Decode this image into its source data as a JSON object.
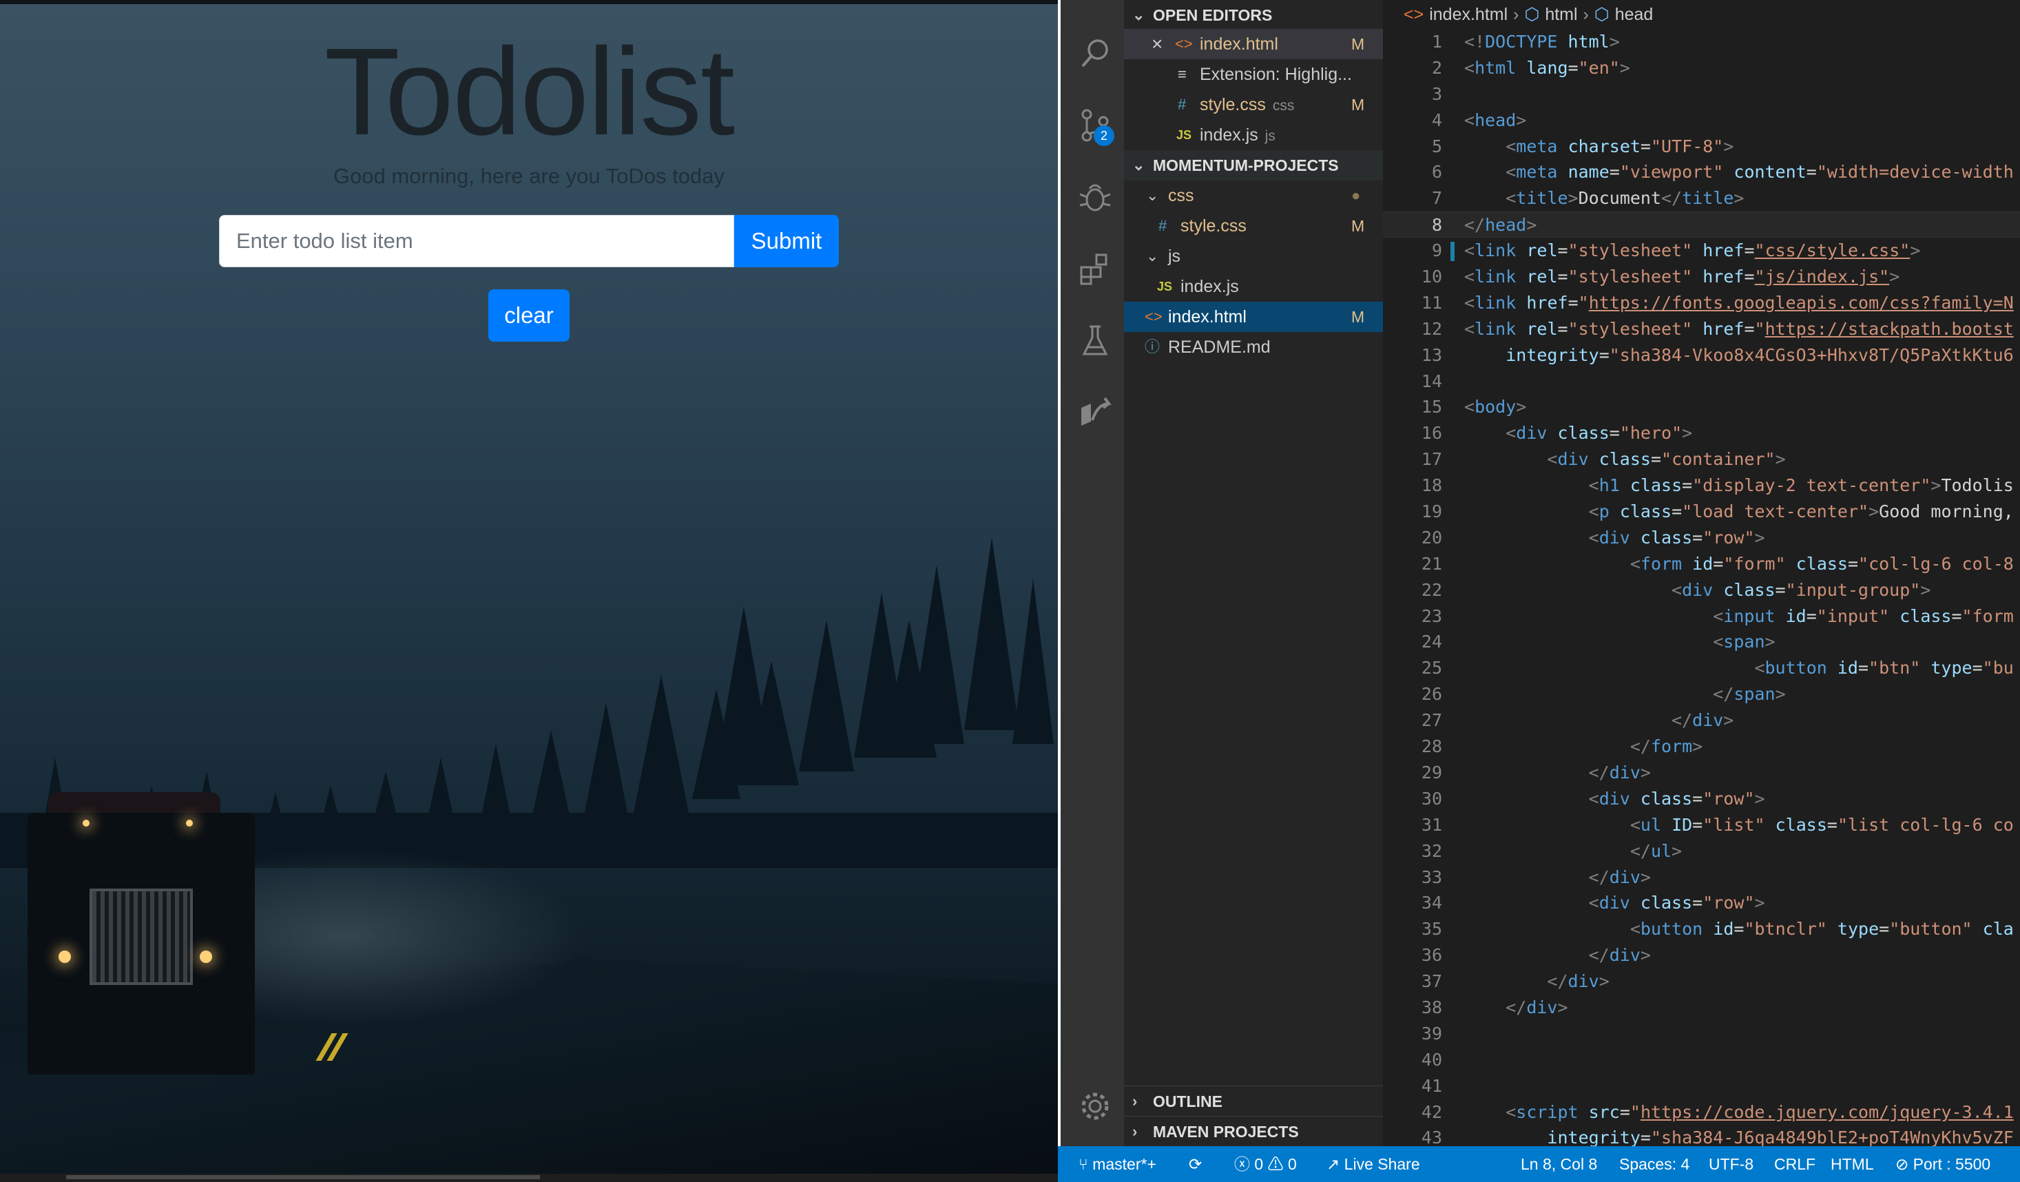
{
  "preview": {
    "title": "Todolist",
    "subtitle": "Good morning, here are you ToDos today",
    "input_placeholder": "Enter todo list item",
    "submit_label": "Submit",
    "clear_label": "clear"
  },
  "activity_bar": {
    "items": [
      "search-icon",
      "source-control-icon",
      "debug-icon",
      "extensions-icon",
      "testing-icon",
      "live-share-icon"
    ],
    "source_control_badge": "2",
    "bottom": "settings-gear-icon"
  },
  "sidebar": {
    "open_editors_header": "OPEN EDITORS",
    "open_editors": [
      {
        "icon": "<>",
        "name": "index.html",
        "status": "M",
        "close": "×"
      },
      {
        "icon": "≡",
        "name": "Extension: Highlig..."
      },
      {
        "icon": "#",
        "name": "style.css",
        "dim": "css",
        "status": "M"
      },
      {
        "icon": "JS",
        "name": "index.js",
        "dim": "js"
      }
    ],
    "project_header": "MOMENTUM-PROJECTS",
    "tree": [
      {
        "icon": "⌄",
        "name": "css",
        "status": "●"
      },
      {
        "icon": "#",
        "name": "style.css",
        "status": "M"
      },
      {
        "icon": "⌄",
        "name": "js"
      },
      {
        "icon": "JS",
        "name": "index.js"
      },
      {
        "icon": "<>",
        "name": "index.html",
        "status": "M"
      },
      {
        "icon": "ⓘ",
        "name": "README.md"
      }
    ],
    "outline_header": "OUTLINE",
    "maven_header": "MAVEN PROJECTS"
  },
  "editor": {
    "breadcrumb": [
      "index.html",
      "html",
      "head"
    ],
    "current_line": 8,
    "lines": [
      [
        [
          "t-brk",
          "<!"
        ],
        [
          "t-tag",
          "DOCTYPE"
        ],
        [
          "t-txt",
          " "
        ],
        [
          "t-attr",
          "html"
        ],
        [
          "t-brk",
          ">"
        ]
      ],
      [
        [
          "t-brk",
          "<"
        ],
        [
          "t-tag",
          "html"
        ],
        [
          "t-txt",
          " "
        ],
        [
          "t-attr",
          "lang"
        ],
        [
          "t-txt",
          "="
        ],
        [
          "t-str",
          "\"en\""
        ],
        [
          "t-brk",
          ">"
        ]
      ],
      [],
      [
        [
          "t-brk",
          "<"
        ],
        [
          "t-tag",
          "head"
        ],
        [
          "t-brk",
          ">"
        ]
      ],
      [
        [
          "t-txt",
          "    "
        ],
        [
          "t-brk",
          "<"
        ],
        [
          "t-tag",
          "meta"
        ],
        [
          "t-txt",
          " "
        ],
        [
          "t-attr",
          "charset"
        ],
        [
          "t-txt",
          "="
        ],
        [
          "t-str",
          "\"UTF-8\""
        ],
        [
          "t-brk",
          ">"
        ]
      ],
      [
        [
          "t-txt",
          "    "
        ],
        [
          "t-brk",
          "<"
        ],
        [
          "t-tag",
          "meta"
        ],
        [
          "t-txt",
          " "
        ],
        [
          "t-attr",
          "name"
        ],
        [
          "t-txt",
          "="
        ],
        [
          "t-str",
          "\"viewport\""
        ],
        [
          "t-txt",
          " "
        ],
        [
          "t-attr",
          "content"
        ],
        [
          "t-txt",
          "="
        ],
        [
          "t-str",
          "\"width=device-width"
        ]
      ],
      [
        [
          "t-txt",
          "    "
        ],
        [
          "t-brk",
          "<"
        ],
        [
          "t-tag",
          "title"
        ],
        [
          "t-brk",
          ">"
        ],
        [
          "t-txt",
          "Document"
        ],
        [
          "t-brk",
          "</"
        ],
        [
          "t-tag",
          "title"
        ],
        [
          "t-brk",
          ">"
        ]
      ],
      [
        [
          "t-brk",
          "</"
        ],
        [
          "t-tag",
          "head"
        ],
        [
          "t-brk",
          ">"
        ]
      ],
      [
        [
          "t-brk",
          "<"
        ],
        [
          "t-tag",
          "link"
        ],
        [
          "t-txt",
          " "
        ],
        [
          "t-attr",
          "rel"
        ],
        [
          "t-txt",
          "="
        ],
        [
          "t-str",
          "\"stylesheet\""
        ],
        [
          "t-txt",
          " "
        ],
        [
          "t-attr",
          "href"
        ],
        [
          "t-txt",
          "="
        ],
        [
          "t-url",
          "\"css/style.css\""
        ],
        [
          "t-brk",
          ">"
        ]
      ],
      [
        [
          "t-brk",
          "<"
        ],
        [
          "t-tag",
          "link"
        ],
        [
          "t-txt",
          " "
        ],
        [
          "t-attr",
          "rel"
        ],
        [
          "t-txt",
          "="
        ],
        [
          "t-str",
          "\"stylesheet\""
        ],
        [
          "t-txt",
          " "
        ],
        [
          "t-attr",
          "href"
        ],
        [
          "t-txt",
          "="
        ],
        [
          "t-url",
          "\"js/index.js\""
        ],
        [
          "t-brk",
          ">"
        ]
      ],
      [
        [
          "t-brk",
          "<"
        ],
        [
          "t-tag",
          "link"
        ],
        [
          "t-txt",
          " "
        ],
        [
          "t-attr",
          "href"
        ],
        [
          "t-txt",
          "="
        ],
        [
          "t-str",
          "\""
        ],
        [
          "t-url",
          "https://fonts.googleapis.com/css?family=N"
        ]
      ],
      [
        [
          "t-brk",
          "<"
        ],
        [
          "t-tag",
          "link"
        ],
        [
          "t-txt",
          " "
        ],
        [
          "t-attr",
          "rel"
        ],
        [
          "t-txt",
          "="
        ],
        [
          "t-str",
          "\"stylesheet\""
        ],
        [
          "t-txt",
          " "
        ],
        [
          "t-attr",
          "href"
        ],
        [
          "t-txt",
          "="
        ],
        [
          "t-str",
          "\""
        ],
        [
          "t-url",
          "https://stackpath.bootst"
        ]
      ],
      [
        [
          "t-txt",
          "    "
        ],
        [
          "t-attr",
          "integrity"
        ],
        [
          "t-txt",
          "="
        ],
        [
          "t-str",
          "\"sha384-Vkoo8x4CGsO3+Hhxv8T/Q5PaXtkKtu6"
        ]
      ],
      [],
      [
        [
          "t-brk",
          "<"
        ],
        [
          "t-tag",
          "body"
        ],
        [
          "t-brk",
          ">"
        ]
      ],
      [
        [
          "t-txt",
          "    "
        ],
        [
          "t-brk",
          "<"
        ],
        [
          "t-tag",
          "div"
        ],
        [
          "t-txt",
          " "
        ],
        [
          "t-attr",
          "class"
        ],
        [
          "t-txt",
          "="
        ],
        [
          "t-str",
          "\"hero\""
        ],
        [
          "t-brk",
          ">"
        ]
      ],
      [
        [
          "t-txt",
          "        "
        ],
        [
          "t-brk",
          "<"
        ],
        [
          "t-tag",
          "div"
        ],
        [
          "t-txt",
          " "
        ],
        [
          "t-attr",
          "class"
        ],
        [
          "t-txt",
          "="
        ],
        [
          "t-str",
          "\"container\""
        ],
        [
          "t-brk",
          ">"
        ]
      ],
      [
        [
          "t-txt",
          "            "
        ],
        [
          "t-brk",
          "<"
        ],
        [
          "t-tag",
          "h1"
        ],
        [
          "t-txt",
          " "
        ],
        [
          "t-attr",
          "class"
        ],
        [
          "t-txt",
          "="
        ],
        [
          "t-str",
          "\"display-2 text-center\""
        ],
        [
          "t-brk",
          ">"
        ],
        [
          "t-txt",
          "Todolis"
        ]
      ],
      [
        [
          "t-txt",
          "            "
        ],
        [
          "t-brk",
          "<"
        ],
        [
          "t-tag",
          "p"
        ],
        [
          "t-txt",
          " "
        ],
        [
          "t-attr",
          "class"
        ],
        [
          "t-txt",
          "="
        ],
        [
          "t-str",
          "\"load text-center\""
        ],
        [
          "t-brk",
          ">"
        ],
        [
          "t-txt",
          "Good morning,"
        ]
      ],
      [
        [
          "t-txt",
          "            "
        ],
        [
          "t-brk",
          "<"
        ],
        [
          "t-tag",
          "div"
        ],
        [
          "t-txt",
          " "
        ],
        [
          "t-attr",
          "class"
        ],
        [
          "t-txt",
          "="
        ],
        [
          "t-str",
          "\"row\""
        ],
        [
          "t-brk",
          ">"
        ]
      ],
      [
        [
          "t-txt",
          "                "
        ],
        [
          "t-brk",
          "<"
        ],
        [
          "t-tag",
          "form"
        ],
        [
          "t-txt",
          " "
        ],
        [
          "t-attr",
          "id"
        ],
        [
          "t-txt",
          "="
        ],
        [
          "t-str",
          "\"form\""
        ],
        [
          "t-txt",
          " "
        ],
        [
          "t-attr",
          "class"
        ],
        [
          "t-txt",
          "="
        ],
        [
          "t-str",
          "\"col-lg-6 col-8"
        ]
      ],
      [
        [
          "t-txt",
          "                    "
        ],
        [
          "t-brk",
          "<"
        ],
        [
          "t-tag",
          "div"
        ],
        [
          "t-txt",
          " "
        ],
        [
          "t-attr",
          "class"
        ],
        [
          "t-txt",
          "="
        ],
        [
          "t-str",
          "\"input-group\""
        ],
        [
          "t-brk",
          ">"
        ]
      ],
      [
        [
          "t-txt",
          "                        "
        ],
        [
          "t-brk",
          "<"
        ],
        [
          "t-tag",
          "input"
        ],
        [
          "t-txt",
          " "
        ],
        [
          "t-attr",
          "id"
        ],
        [
          "t-txt",
          "="
        ],
        [
          "t-str",
          "\"input\""
        ],
        [
          "t-txt",
          " "
        ],
        [
          "t-attr",
          "class"
        ],
        [
          "t-txt",
          "="
        ],
        [
          "t-str",
          "\"form"
        ]
      ],
      [
        [
          "t-txt",
          "                        "
        ],
        [
          "t-brk",
          "<"
        ],
        [
          "t-tag",
          "span"
        ],
        [
          "t-brk",
          ">"
        ]
      ],
      [
        [
          "t-txt",
          "                            "
        ],
        [
          "t-brk",
          "<"
        ],
        [
          "t-tag",
          "button"
        ],
        [
          "t-txt",
          " "
        ],
        [
          "t-attr",
          "id"
        ],
        [
          "t-txt",
          "="
        ],
        [
          "t-str",
          "\"btn\""
        ],
        [
          "t-txt",
          " "
        ],
        [
          "t-attr",
          "type"
        ],
        [
          "t-txt",
          "="
        ],
        [
          "t-str",
          "\"bu"
        ]
      ],
      [
        [
          "t-txt",
          "                        "
        ],
        [
          "t-brk",
          "</"
        ],
        [
          "t-tag",
          "span"
        ],
        [
          "t-brk",
          ">"
        ]
      ],
      [
        [
          "t-txt",
          "                    "
        ],
        [
          "t-brk",
          "</"
        ],
        [
          "t-tag",
          "div"
        ],
        [
          "t-brk",
          ">"
        ]
      ],
      [
        [
          "t-txt",
          "                "
        ],
        [
          "t-brk",
          "</"
        ],
        [
          "t-tag",
          "form"
        ],
        [
          "t-brk",
          ">"
        ]
      ],
      [
        [
          "t-txt",
          "            "
        ],
        [
          "t-brk",
          "</"
        ],
        [
          "t-tag",
          "div"
        ],
        [
          "t-brk",
          ">"
        ]
      ],
      [
        [
          "t-txt",
          "            "
        ],
        [
          "t-brk",
          "<"
        ],
        [
          "t-tag",
          "div"
        ],
        [
          "t-txt",
          " "
        ],
        [
          "t-attr",
          "class"
        ],
        [
          "t-txt",
          "="
        ],
        [
          "t-str",
          "\"row\""
        ],
        [
          "t-brk",
          ">"
        ]
      ],
      [
        [
          "t-txt",
          "                "
        ],
        [
          "t-brk",
          "<"
        ],
        [
          "t-tag",
          "ul"
        ],
        [
          "t-txt",
          " "
        ],
        [
          "t-attr",
          "ID"
        ],
        [
          "t-txt",
          "="
        ],
        [
          "t-str",
          "\"list\""
        ],
        [
          "t-txt",
          " "
        ],
        [
          "t-attr",
          "class"
        ],
        [
          "t-txt",
          "="
        ],
        [
          "t-str",
          "\"list col-lg-6 co"
        ]
      ],
      [
        [
          "t-txt",
          "                "
        ],
        [
          "t-brk",
          "</"
        ],
        [
          "t-tag",
          "ul"
        ],
        [
          "t-brk",
          ">"
        ]
      ],
      [
        [
          "t-txt",
          "            "
        ],
        [
          "t-brk",
          "</"
        ],
        [
          "t-tag",
          "div"
        ],
        [
          "t-brk",
          ">"
        ]
      ],
      [
        [
          "t-txt",
          "            "
        ],
        [
          "t-brk",
          "<"
        ],
        [
          "t-tag",
          "div"
        ],
        [
          "t-txt",
          " "
        ],
        [
          "t-attr",
          "class"
        ],
        [
          "t-txt",
          "="
        ],
        [
          "t-str",
          "\"row\""
        ],
        [
          "t-brk",
          ">"
        ]
      ],
      [
        [
          "t-txt",
          "                "
        ],
        [
          "t-brk",
          "<"
        ],
        [
          "t-tag",
          "button"
        ],
        [
          "t-txt",
          " "
        ],
        [
          "t-attr",
          "id"
        ],
        [
          "t-txt",
          "="
        ],
        [
          "t-str",
          "\"btnclr\""
        ],
        [
          "t-txt",
          " "
        ],
        [
          "t-attr",
          "type"
        ],
        [
          "t-txt",
          "="
        ],
        [
          "t-str",
          "\"button\""
        ],
        [
          "t-txt",
          " "
        ],
        [
          "t-attr",
          "cla"
        ]
      ],
      [
        [
          "t-txt",
          "            "
        ],
        [
          "t-brk",
          "</"
        ],
        [
          "t-tag",
          "div"
        ],
        [
          "t-brk",
          ">"
        ]
      ],
      [
        [
          "t-txt",
          "        "
        ],
        [
          "t-brk",
          "</"
        ],
        [
          "t-tag",
          "div"
        ],
        [
          "t-brk",
          ">"
        ]
      ],
      [
        [
          "t-txt",
          "    "
        ],
        [
          "t-brk",
          "</"
        ],
        [
          "t-tag",
          "div"
        ],
        [
          "t-brk",
          ">"
        ]
      ],
      [],
      [],
      [],
      [
        [
          "t-txt",
          "    "
        ],
        [
          "t-brk",
          "<"
        ],
        [
          "t-tag",
          "script"
        ],
        [
          "t-txt",
          " "
        ],
        [
          "t-attr",
          "src"
        ],
        [
          "t-txt",
          "="
        ],
        [
          "t-str",
          "\""
        ],
        [
          "t-url",
          "https://code.jquery.com/jquery-3.4.1"
        ]
      ],
      [
        [
          "t-txt",
          "        "
        ],
        [
          "t-attr",
          "integrity"
        ],
        [
          "t-txt",
          "="
        ],
        [
          "t-str",
          "\"sha384-J6qa4849blE2+poT4WnyKhv5vZF"
        ]
      ]
    ]
  },
  "statusbar": {
    "branch": "master*+",
    "sync": "⟳",
    "errors": "0",
    "warnings": "0",
    "live_share": "Live Share",
    "position": "Ln 8, Col 8",
    "spaces": "Spaces: 4",
    "encoding": "UTF-8",
    "eol": "CRLF",
    "language": "HTML",
    "port": "Port : 5500"
  }
}
